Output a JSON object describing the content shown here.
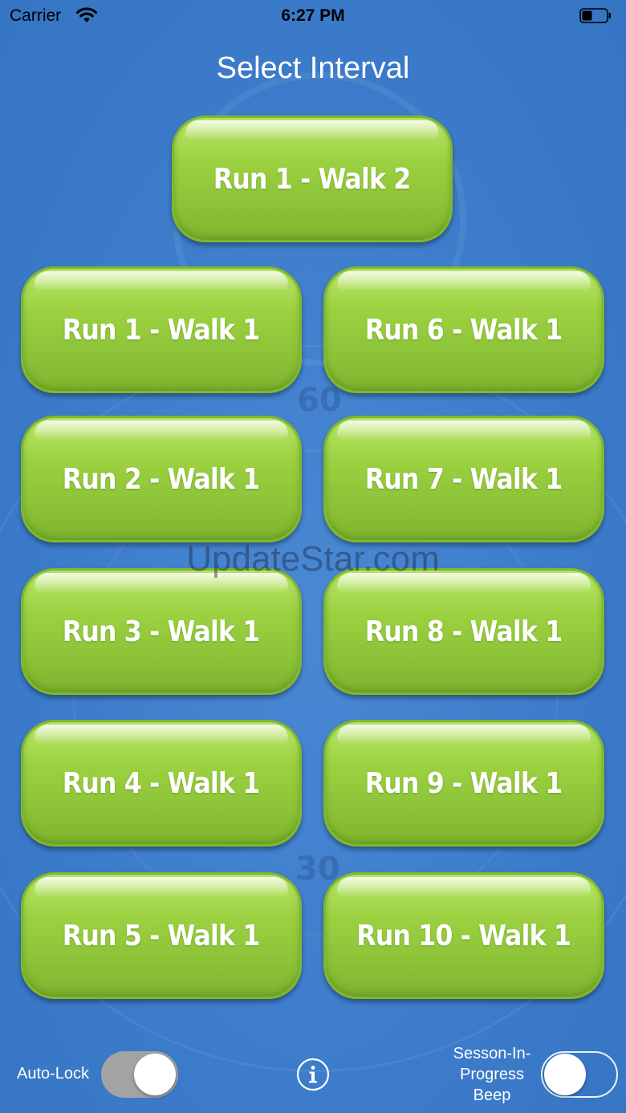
{
  "status_bar": {
    "carrier": "Carrier",
    "time": "6:27 PM"
  },
  "title": "Select Interval",
  "buttons": {
    "top": "Run 1 - Walk 2",
    "left": [
      "Run 1 - Walk 1",
      "Run 2 - Walk 1",
      "Run 3 - Walk 1",
      "Run 4 - Walk 1",
      "Run 5 - Walk 1"
    ],
    "right": [
      "Run 6 - Walk 1",
      "Run 7 - Walk 1",
      "Run 8 - Walk 1",
      "Run 9 - Walk 1",
      "Run 10 - Walk 1"
    ]
  },
  "background_dial": {
    "numbers": [
      "60",
      "30"
    ]
  },
  "watermark": "UpdateStar.com",
  "bottom_bar": {
    "auto_lock_label": "Auto-Lock",
    "auto_lock_on": true,
    "beep_label_line1": "Sesson-In-",
    "beep_label_line2": "Progress",
    "beep_label_line3": "Beep",
    "beep_on": false,
    "info_icon": "info-icon"
  },
  "colors": {
    "background": "#3b7ccb",
    "button_green": "#9cd140",
    "text": "#ffffff"
  }
}
